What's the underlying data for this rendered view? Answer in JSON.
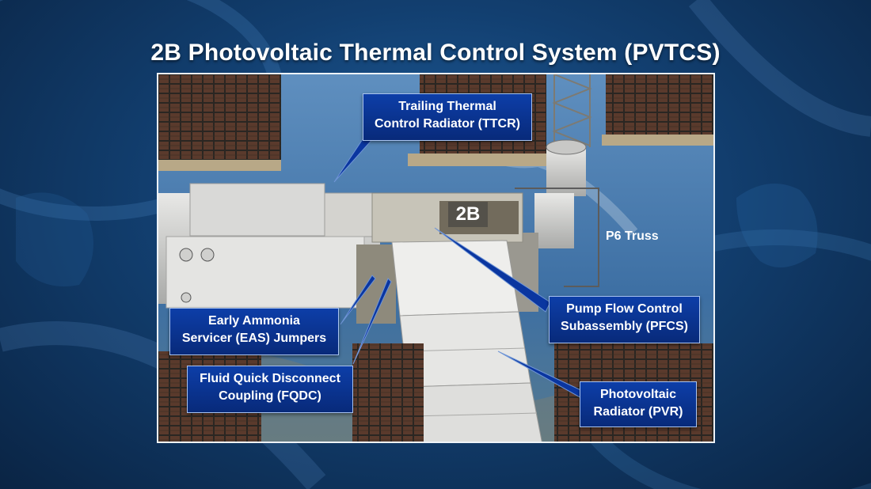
{
  "title": "2B Photovoltaic Thermal Control System (PVTCS)",
  "labels": {
    "section": "2B",
    "truss": "P6 Truss"
  },
  "callouts": {
    "ttcr": [
      "Trailing Thermal",
      "Control Radiator (TTCR)"
    ],
    "pfcs": [
      "Pump Flow Control",
      "Subassembly (PFCS)"
    ],
    "eas": [
      "Early Ammonia",
      "Servicer (EAS) Jumpers"
    ],
    "fqdc": [
      "Fluid Quick Disconnect",
      "Coupling (FQDC)"
    ],
    "pvr": [
      "Photovoltaic",
      "Radiator (PVR)"
    ]
  },
  "colors": {
    "callout_fill": "#0b37a0",
    "callout_border": "#a9c4f0",
    "background": "#123f70"
  }
}
